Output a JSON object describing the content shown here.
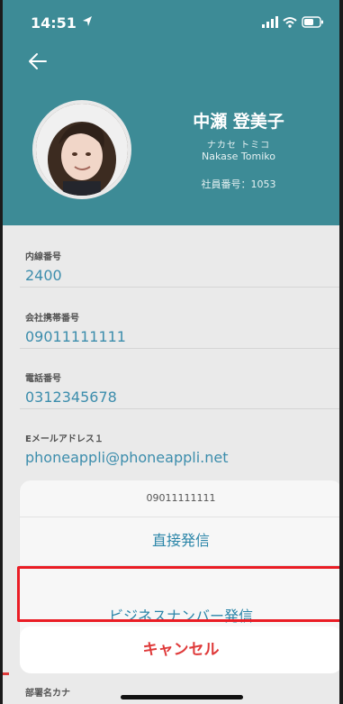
{
  "status_bar": {
    "time": "14:51"
  },
  "profile": {
    "name": "中瀬 登美子",
    "kana": "ナカセ トミコ",
    "roman": "Nakase Tomiko",
    "employee_label": "社員番号：",
    "employee_no": "1053"
  },
  "fields": [
    {
      "label": "内線番号",
      "value": "2400"
    },
    {
      "label": "会社携帯番号",
      "value": "09011111111"
    },
    {
      "label": "電話番号",
      "value": "0312345678"
    },
    {
      "label": "Eメールアドレス１",
      "value": "phoneappli@phoneappli.net"
    }
  ],
  "action_sheet": {
    "title": "09011111111",
    "direct_call": "直接発信",
    "business_call": "ビジネスナンバー発信",
    "cancel": "キャンセル"
  },
  "below_sheet_label": "部署名カナ",
  "colors": {
    "header": "#3d8b96",
    "link": "#3f93b4",
    "danger": "#df3a3a",
    "highlight": "#ea1d25"
  }
}
